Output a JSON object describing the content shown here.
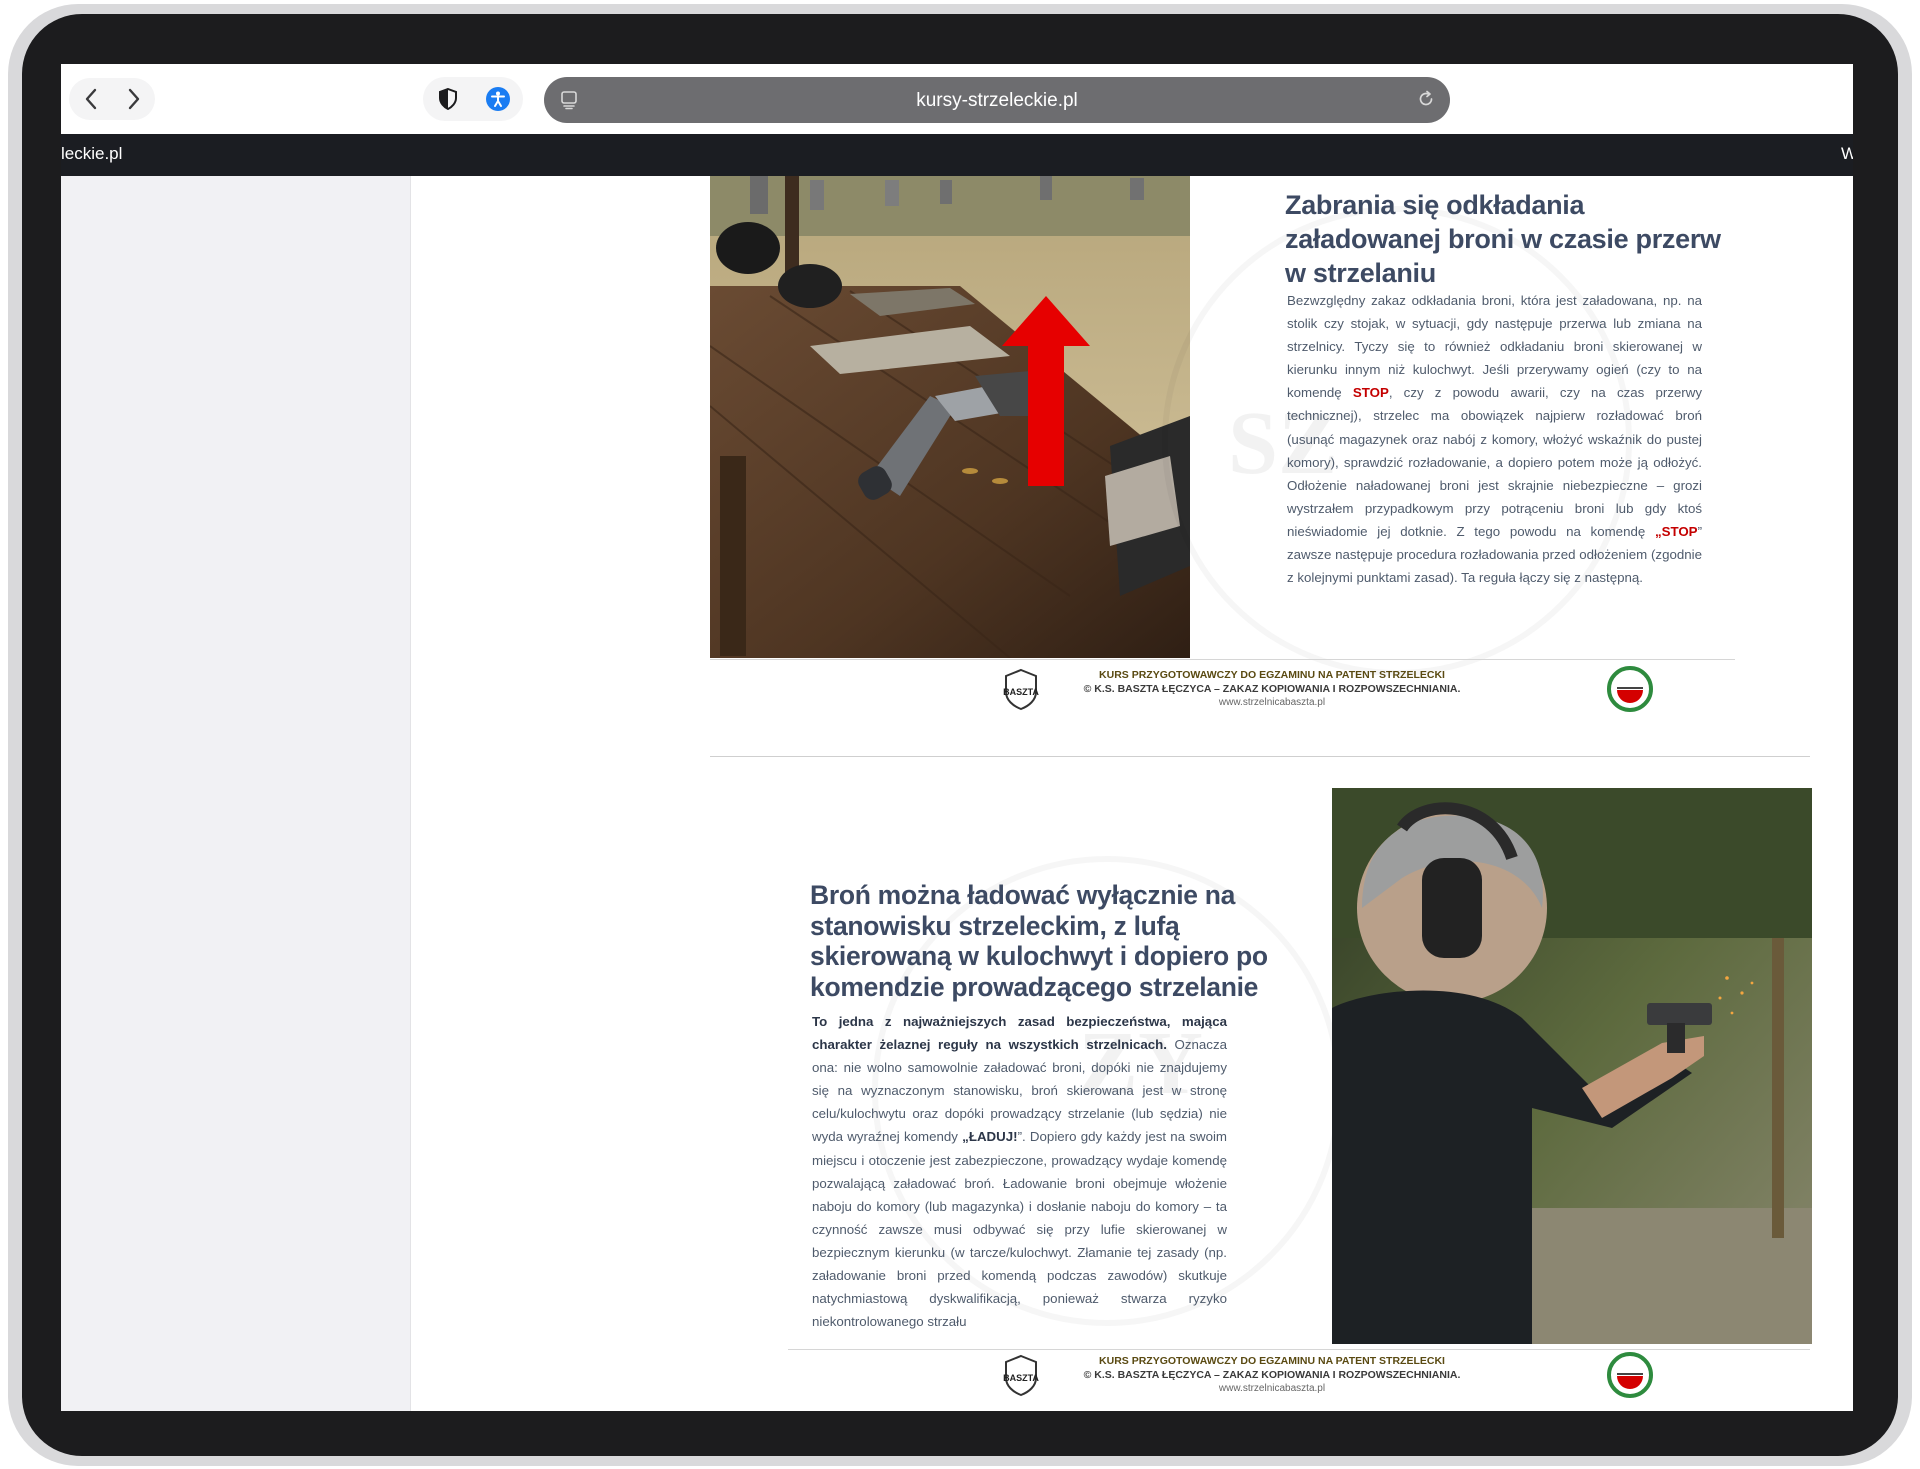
{
  "browser": {
    "url": "kursy-strzeleckie.pl",
    "tab_left_text": "leckie.pl",
    "tab_right_text": "W"
  },
  "page1": {
    "title": "Zabrania się odkładania załadowanej broni w czasie przerw w strzelaniu",
    "body": {
      "p1": "Bezwzględny zakaz odkładania broni, która jest załadowana, np. na stolik czy stojak, w sytuacji, gdy następuje przerwa lub zmiana na strzelnicy. Tyczy się to również odkładaniu broni skierowanej w kierunku innym niż kulochwyt. Jeśli przerywamy ogień (czy to na komendę ",
      "stop1": "STOP",
      "p2": ", czy z powodu awarii, czy na czas przerwy technicznej), strzelec ma obowiązek najpierw rozładować broń (usunąć magazynek oraz  nabój z komory, włożyć wskaźnik do pustej komory), sprawdzić rozładowanie, a dopiero potem może ją odłożyć. Odłożenie naładowanej broni jest skrajnie niebezpieczne – grozi wystrzałem przypadkowym przy potrąceniu broni lub gdy ktoś nieświadomie jej dotknie. Z tego powodu na komendę ",
      "stop2": "„STOP",
      "p3": "” zawsze następuje procedura rozładowania przed odłożeniem (zgodnie z kolejnymi punktami zasad). Ta reguła łączy się z następną."
    }
  },
  "page2": {
    "title": "Broń można ładować wyłącznie na stanowisku strzeleckim, z lufą skierowaną w kulochwyt i dopiero po komendzie prowadzącego strzelanie",
    "body": {
      "bold": "To jedna z najważniejszych zasad bezpieczeństwa, mająca charakter żelaznej reguły na wszystkich strzelnicach.",
      "p1": " Oznacza ona: nie wolno samowolnie załadować broni, dopóki nie znajdujemy się na wyznaczonym stanowisku, broń skierowana jest w stronę celu/kulochwytu oraz dopóki prowadzący strzelanie (lub sędzia) nie wyda wyraźnej komendy ",
      "laduj": "„ŁADUJ!",
      "p2": "”. Dopiero gdy każdy jest na swoim miejscu i otoczenie jest zabezpieczone, prowadzący wydaje komendę pozwalającą załadować broń. Ładowanie broni obejmuje włożenie naboju do komory (lub magazynka) i dosłanie naboju do komory – ta czynność zawsze musi odbywać się przy lufie skierowanej w bezpiecznym kierunku (w tarcze/kulochwyt. Złamanie tej zasady (np. załadowanie broni przed komendą podczas zawodów) skutkuje natychmiastową dyskwalifikacją, ponieważ stwarza ryzyko niekontrolowanego strzału"
    }
  },
  "footer": {
    "line1": "KURS PRZYGOTOWAWCZY DO EGZAMINU NA PATENT STRZELECKI",
    "line2": "© K.S. BASZTA ŁĘCZYCA – ZAKAZ KOPIOWANIA I ROZPOWSZECHNIANIA.",
    "line3": "www.strzelnicabaszta.pl"
  },
  "icons": {
    "back": "chevron-left-icon",
    "forward": "chevron-right-icon",
    "shield": "shield-icon",
    "accessibility": "accessibility-icon",
    "reload": "reload-icon"
  },
  "colors": {
    "title": "#3d4a63",
    "stop": "#c40000",
    "arrow": "#e60000",
    "tabstrip": "#1b1d22",
    "urlbar": "#6d6d70"
  }
}
